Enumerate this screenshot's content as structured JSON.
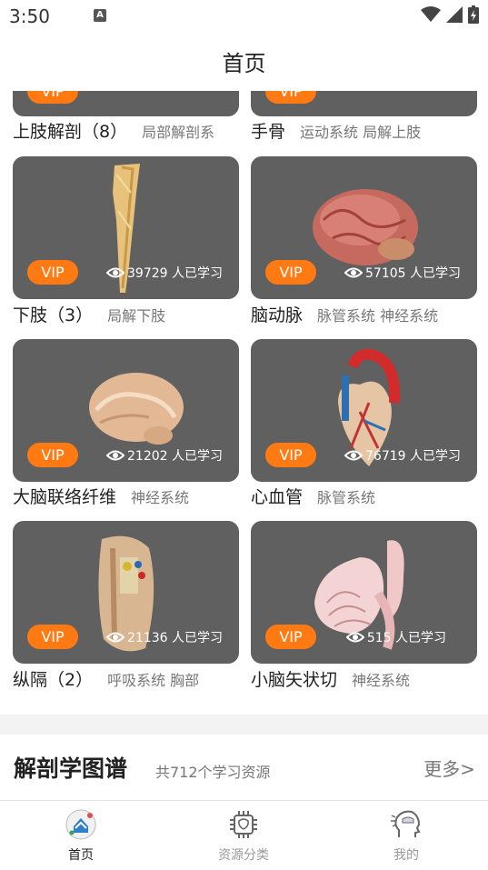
{
  "status_bar": {
    "time": "3:50",
    "a_icon": "A"
  },
  "header": {
    "title": "首页"
  },
  "top_partial": [
    {
      "title": "上肢解剖（8）",
      "tags": "局部解剖系",
      "vip": "VIP"
    },
    {
      "title": "手骨",
      "tags": "运动系统 局解上肢",
      "vip": "VIP"
    }
  ],
  "cards": [
    {
      "title": "下肢（3）",
      "tags": "局解下肢",
      "vip": "VIP",
      "views": "39729 人已学习",
      "image": "lower-limb-model"
    },
    {
      "title": "脑动脉",
      "tags": "脉管系统 神经系统",
      "vip": "VIP",
      "views": "57105 人已学习",
      "image": "brain-arteries-model"
    },
    {
      "title": "大脑联络纤维",
      "tags": "神经系统",
      "vip": "VIP",
      "views": "21202 人已学习",
      "image": "brain-fibers-model"
    },
    {
      "title": "心血管",
      "tags": "脉管系统",
      "vip": "VIP",
      "views": "76719 人已学习",
      "image": "heart-model"
    },
    {
      "title": "纵隔（2）",
      "tags": "呼吸系统 胸部",
      "vip": "VIP",
      "views": "21136 人已学习",
      "image": "mediastinum-model"
    },
    {
      "title": "小脑矢状切",
      "tags": "神经系统",
      "vip": "VIP",
      "views": "515 人已学习",
      "image": "cerebellum-model"
    }
  ],
  "section": {
    "title": "解剖学图谱",
    "subtitle": "共712个学习资源",
    "more": "更多>"
  },
  "tabs": [
    {
      "label": "首页",
      "active": true,
      "icon": "home-icon"
    },
    {
      "label": "资源分类",
      "active": false,
      "icon": "chip-icon"
    },
    {
      "label": "我的",
      "active": false,
      "icon": "head-profile-icon"
    }
  ],
  "colors": {
    "vip": "#ff7a12",
    "card_bg": "#606060",
    "active_tab": "#222222",
    "inactive_tab": "#999999"
  }
}
